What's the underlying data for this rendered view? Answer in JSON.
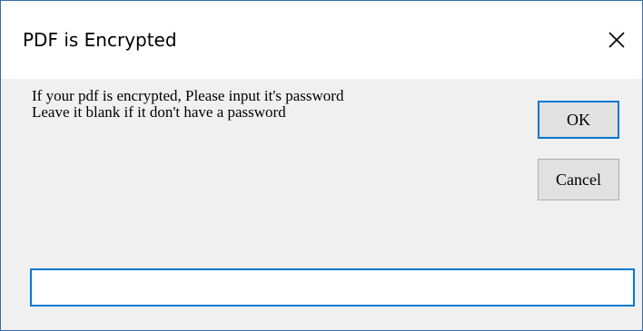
{
  "dialog": {
    "title": "PDF is Encrypted",
    "close_icon": "close-icon",
    "message_lines": [
      "If your pdf is encrypted, Please input it's password",
      "Leave it blank if it don't have a password"
    ],
    "buttons": {
      "ok_label": "OK",
      "cancel_label": "Cancel"
    },
    "password_field": {
      "value": ""
    },
    "colors": {
      "focus_border": "#0078d7",
      "window_border": "#3a6ea5",
      "client_bg": "#f0f0f0",
      "button_bg": "#e1e1e1"
    }
  }
}
